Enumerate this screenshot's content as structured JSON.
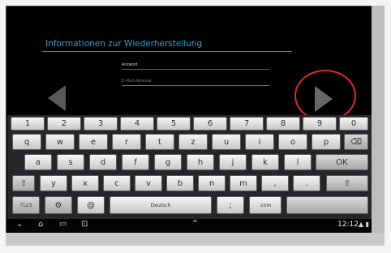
{
  "screen": {
    "title": "Informationen zur Wiederherstellung",
    "answer_label": "Antwort",
    "email_placeholder": "E-Mail-Adresse"
  },
  "icons": {
    "back": "back-arrow-icon",
    "forward": "forward-arrow-icon",
    "highlight": "red-circle-annotation",
    "shift": "shift-icon",
    "backspace": "backspace-icon",
    "settings": "gear-icon",
    "nav": [
      "chevron-down-icon",
      "home-icon",
      "recent-apps-icon",
      "screenshot-icon"
    ],
    "signal": "signal-icon",
    "battery": "battery-icon"
  },
  "keyboard": {
    "number_row": [
      "1",
      "2",
      "3",
      "4",
      "5",
      "6",
      "7",
      "8",
      "9",
      "0"
    ],
    "row1": [
      "q",
      "w",
      "e",
      "r",
      "t",
      "z",
      "u",
      "i",
      "o",
      "p"
    ],
    "row2": [
      "a",
      "s",
      "d",
      "f",
      "g",
      "h",
      "j",
      "k",
      "l"
    ],
    "row3": [
      "y",
      "x",
      "c",
      "v",
      "b",
      "n",
      "m",
      ",",
      "."
    ],
    "ok_label": "OK",
    "bottom": {
      "symbols_label": "?123",
      "at_label": "@",
      "space_label": "Deutsch",
      "semicolon_label": ";",
      "dotcom_label": ".com"
    }
  },
  "status": {
    "time": "12:12"
  }
}
